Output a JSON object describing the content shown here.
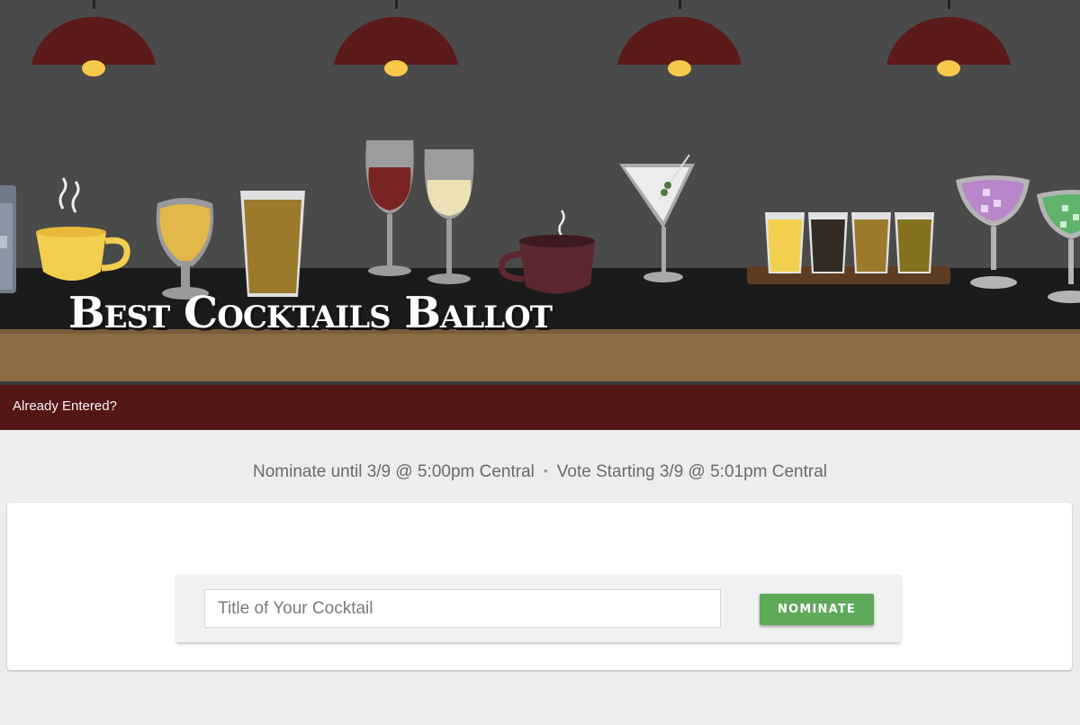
{
  "hero": {
    "title": "Best Cocktails Ballot"
  },
  "subbar": {
    "already_entered": "Already Entered?"
  },
  "schedule": {
    "nominate": "Nominate until 3/9 @ 5:00pm Central",
    "separator": "•",
    "vote": "Vote Starting 3/9 @ 5:01pm Central"
  },
  "form": {
    "title_placeholder": "Title of Your Cocktail",
    "title_value": "",
    "nominate_label": "NOMINATE"
  },
  "colors": {
    "wall": "#4a4a4a",
    "counter": "#1c1b1c",
    "bar_wood": "#8b6c44",
    "subbar": "#551617",
    "lamp": "#5c1a1a",
    "bulb": "#f6c94a",
    "button": "#5ea95a"
  },
  "illustration_icons": [
    "pendant-lamp-icon",
    "glass-icon",
    "coffee-cup-icon",
    "tulip-beer-glass-icon",
    "pint-glass-icon",
    "red-wine-glass-icon",
    "white-wine-glass-icon",
    "mug-icon",
    "martini-glass-icon",
    "beer-flight-icon",
    "margarita-glass-icon"
  ]
}
